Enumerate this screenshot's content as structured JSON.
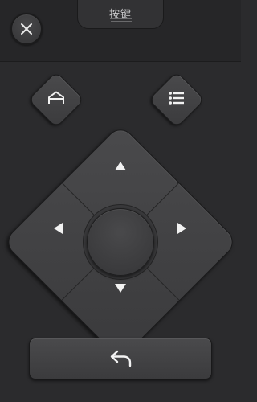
{
  "header": {
    "tab_label": "按键",
    "close_icon": "close-icon"
  },
  "remote": {
    "home_icon": "home-icon",
    "menu_icon": "menu-list-icon",
    "dpad": {
      "up_icon": "arrow-up-icon",
      "down_icon": "arrow-down-icon",
      "left_icon": "arrow-left-icon",
      "right_icon": "arrow-right-icon",
      "center_label": ""
    },
    "back_icon": "back-arrow-icon"
  },
  "colors": {
    "background": "#2b2b2d",
    "button": "#434345",
    "icon": "#f2f2f2",
    "text": "#c9c9cb"
  }
}
